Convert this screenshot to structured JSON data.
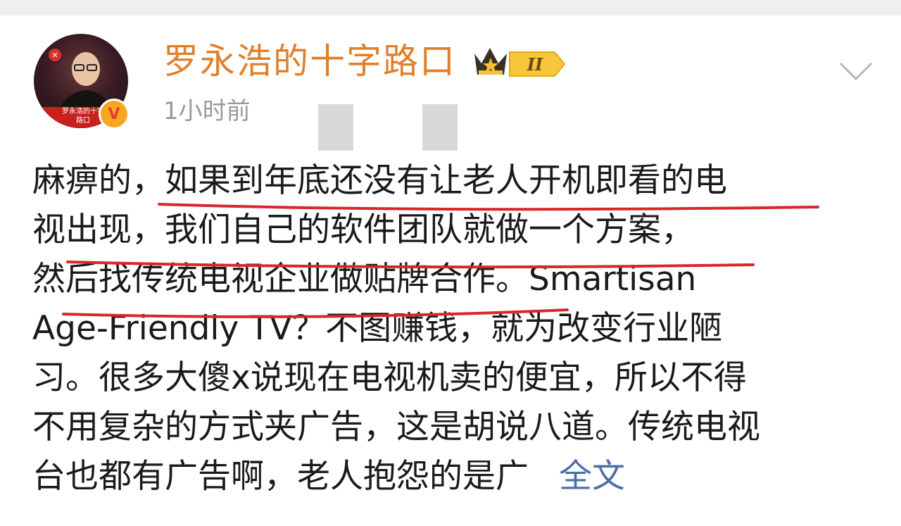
{
  "post": {
    "username": "罗永浩的十字路口",
    "level_badge": "II",
    "timestamp": "1小时前",
    "avatar_caption": "罗永浩的十字路口",
    "lines": [
      "麻痹的，如果到年底还没有让老人开机即看的电",
      "视出现，我们自己的软件团队就做一个方案，",
      "然后找传统电视企业做贴牌合作。Smartisan",
      "Age-Friendly TV？不图赚钱，就为改变行业陋",
      "习。很多大傻x说现在电视机卖的便宜，所以不得",
      "不用复杂的方式夹广告，这是胡说八道。传统电视",
      "台也都有广告啊，老人抱怨的是广"
    ],
    "expand_label": "全文"
  },
  "icons": {
    "verified": "verified-v-icon",
    "crown": "crown-level-badge-icon",
    "more": "chevron-down-icon"
  },
  "colors": {
    "username": "#e07f2a",
    "link": "#4c6fa8",
    "highlight_underline": "#d9262b",
    "timestamp": "#9a9a9a"
  }
}
